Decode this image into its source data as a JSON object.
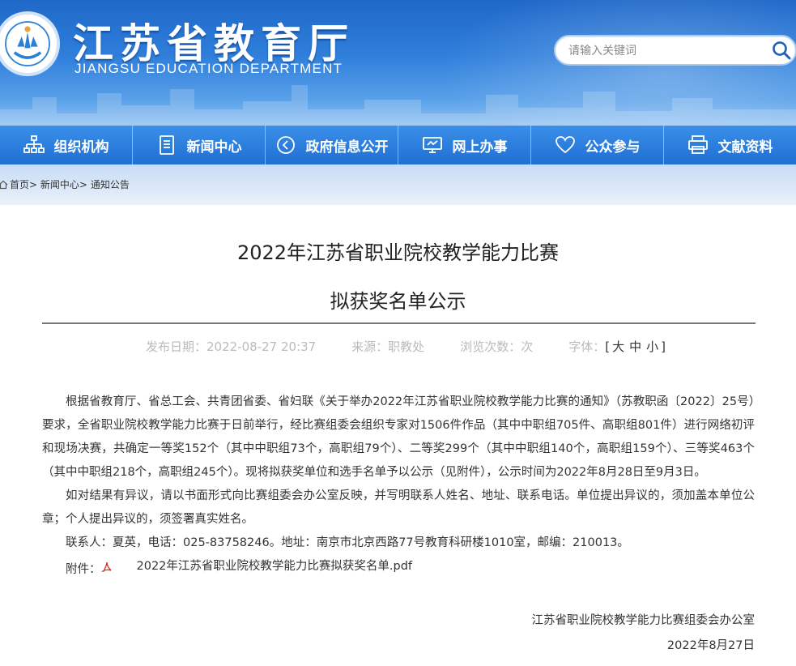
{
  "header": {
    "title": "江苏省教育厅",
    "subtitle": "JIANGSU EDUCATION DEPARTMENT",
    "search_placeholder": "请输入关键词"
  },
  "nav": [
    {
      "label": "组织机构",
      "icon": "org-chart-icon"
    },
    {
      "label": "新闻中心",
      "icon": "document-icon"
    },
    {
      "label": "政府信息公开",
      "icon": "play-circle-icon"
    },
    {
      "label": "网上办事",
      "icon": "monitor-icon"
    },
    {
      "label": "公众参与",
      "icon": "heart-icon"
    },
    {
      "label": "文献资料",
      "icon": "printer-icon"
    }
  ],
  "breadcrumb": {
    "home": "首页",
    "sep": ">",
    "news": "新闻中心",
    "notice": "通知公告"
  },
  "article": {
    "title_line1": "2022年江苏省职业院校教学能力比赛",
    "title_line2": "拟获奖名单公示",
    "meta": {
      "date": "发布日期：2022-08-27 20:37",
      "source": "来源：职教处",
      "views": "浏览次数：次",
      "font_label": "字体：",
      "bracket_open": "[",
      "bracket_close": "]",
      "font_large": "大",
      "font_medium": "中",
      "font_small": "小"
    },
    "paragraphs": [
      "根据省教育厅、省总工会、共青团省委、省妇联《关于举办2022年江苏省职业院校教学能力比赛的通知》（苏教职函〔2022〕25号）要求，全省职业院校教学能力比赛于日前举行，经比赛组委会组织专家对1506件作品（其中中职组705件、高职组801件）进行网络初评和现场决赛，共确定一等奖152个（其中中职组73个，高职组79个）、二等奖299个（其中中职组140个，高职组159个）、三等奖463个（其中中职组218个，高职组245个）。现将拟获奖单位和选手名单予以公示（见附件），公示时间为2022年8月28日至9月3日。",
      "如对结果有异议，请以书面形式向比赛组委会办公室反映，并写明联系人姓名、地址、联系电话。单位提出异议的，须加盖本单位公章；个人提出异议的，须签署真实姓名。",
      "联系人：夏英，电话：025-83758246。地址：南京市北京西路77号教育科研楼1010室，邮编：210013。"
    ],
    "attachment_label": "附件：",
    "attachment_file": "2022年江苏省职业院校教学能力比赛拟获奖名单.pdf",
    "signature": "江苏省职业院校教学能力比赛组委会办公室",
    "sign_date": "2022年8月27日"
  }
}
